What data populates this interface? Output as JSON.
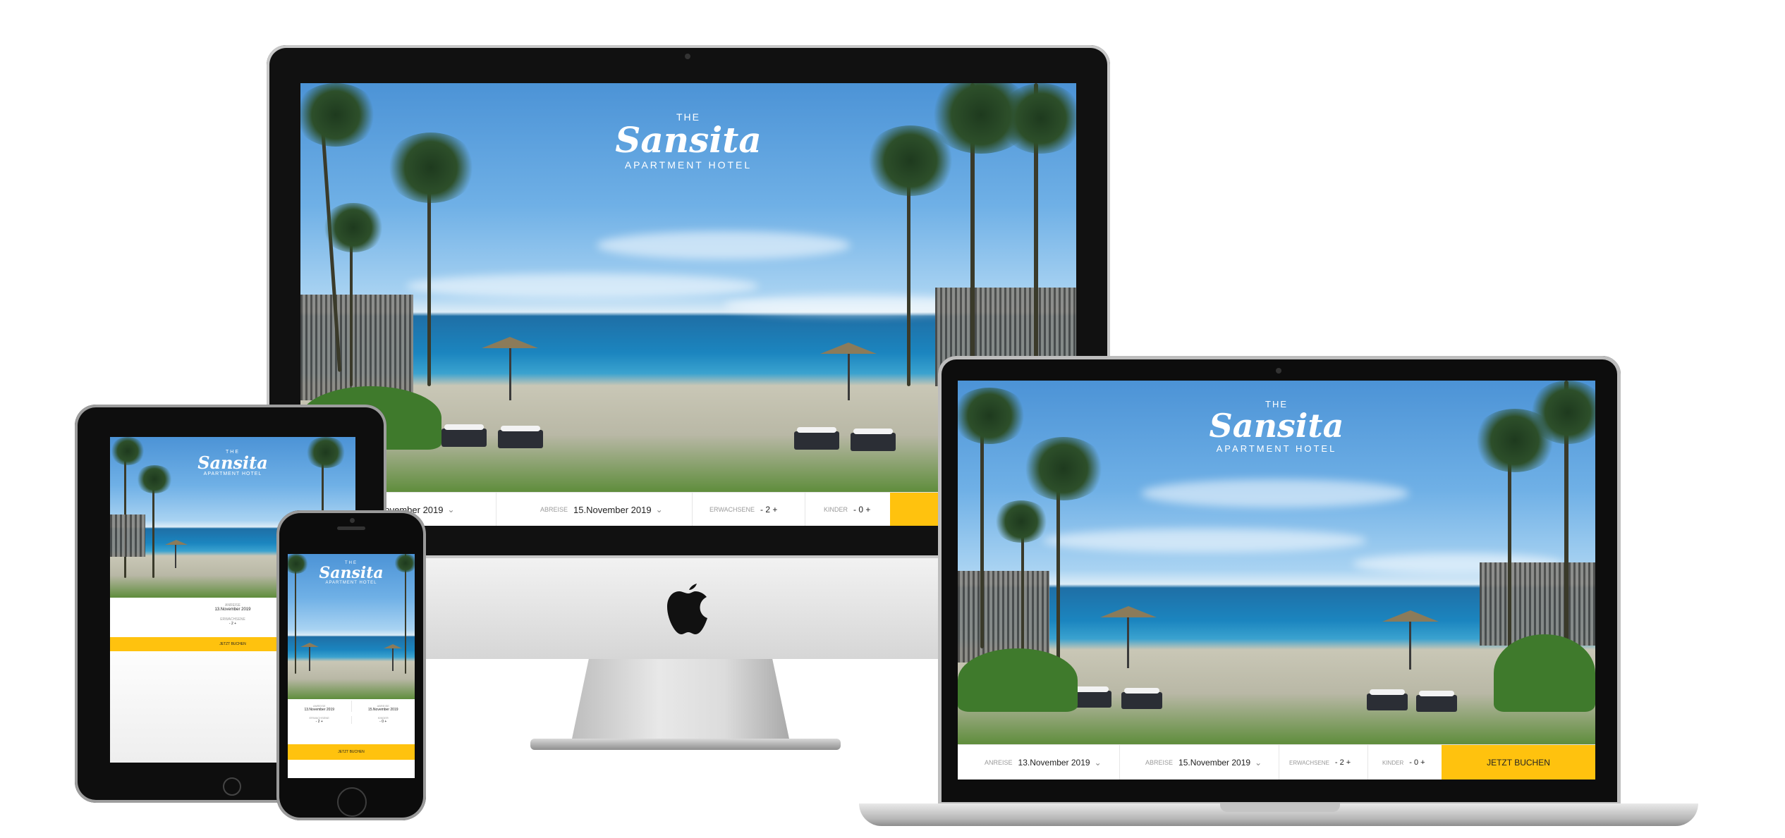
{
  "brand": {
    "the": "THE",
    "name": "Sansita",
    "subtitle": "APARTMENT HOTEL"
  },
  "booking": {
    "arrival_label": "ANREISE",
    "arrival_value": "13.November 2019",
    "departure_label": "ABREISE",
    "departure_value": "15.November 2019",
    "adults_label": "ERWACHSENE",
    "adults_value": "- 2 +",
    "children_label": "KINDER",
    "children_value": "- 0 +",
    "submit_label": "JETZT BUCHEN"
  },
  "imac_booking": {
    "arrival_value": "November 2019"
  },
  "colors": {
    "accent": "#ffc20e",
    "device_black": "#111111",
    "aluminum": "#d6d6d6"
  },
  "icons": {
    "apple_logo": "apple-icon",
    "chevron": "chevron-down-icon"
  }
}
